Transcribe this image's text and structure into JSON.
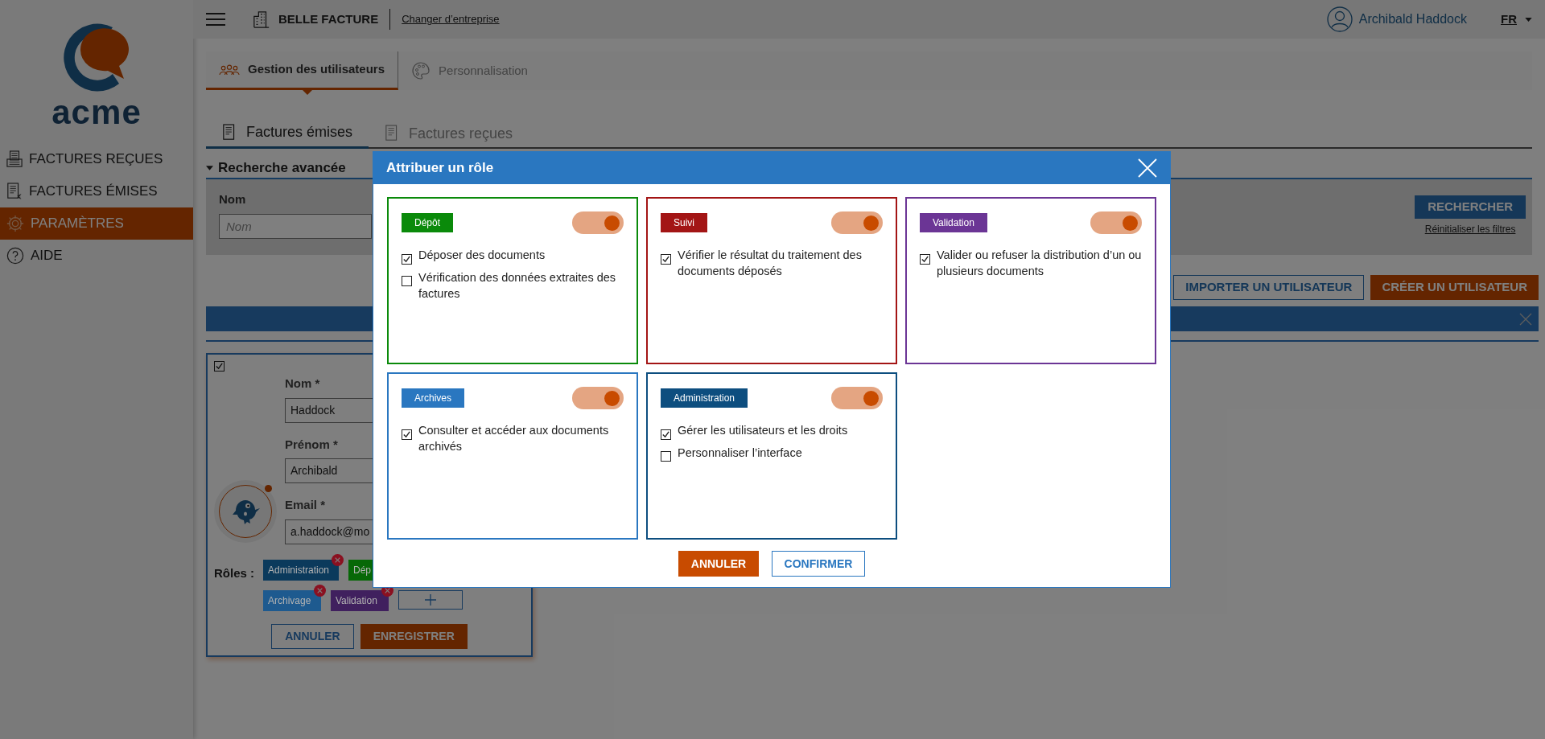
{
  "logo": {
    "text": "acme"
  },
  "sidebar": {
    "items": [
      {
        "label": "FACTURES REÇUES",
        "selected": false
      },
      {
        "label": "FACTURES ÉMISES",
        "selected": false
      },
      {
        "label": "PARAMÈTRES",
        "selected": true
      },
      {
        "label": "AIDE",
        "selected": false
      }
    ]
  },
  "topbar": {
    "company": "BELLE FACTURE",
    "switch_link": "Changer d’entreprise",
    "user": "Archibald Haddock",
    "language": "FR"
  },
  "tabs": [
    {
      "label": "Gestion des utilisateurs",
      "selected": true
    },
    {
      "label": "Personnalisation",
      "selected": false
    }
  ],
  "subtabs": [
    {
      "label": "Factures émises",
      "selected": true
    },
    {
      "label": "Factures reçues",
      "selected": false
    }
  ],
  "search": {
    "title": "Recherche avancée",
    "expanded": true,
    "field_label": "Nom",
    "placeholder": "Nom",
    "search_button": "RECHERCHER",
    "reset_link": "Réinitialiser les filtres"
  },
  "actions": {
    "import": "IMPORTER UN UTILISATEUR",
    "create": "CRÉER UN UTILISATEUR"
  },
  "user_card": {
    "checked": true,
    "fields": [
      {
        "label": "Nom *",
        "value": "Haddock"
      },
      {
        "label": "Prénom *",
        "value": "Archibald"
      },
      {
        "label": "Email *",
        "value": "a.haddock@mo"
      }
    ],
    "roles_label": "Rôles :",
    "roles": [
      {
        "label": "Administration",
        "color": "#0b3a5c",
        "removable": true
      },
      {
        "label": "Dép",
        "color": "#076807"
      },
      {
        "label": "Archivage",
        "color": "#1e5a8f",
        "removable": true
      },
      {
        "label": "Validation",
        "color": "#40205e",
        "removable": true
      }
    ],
    "cancel": "ANNULER",
    "save": "ENREGISTRER"
  },
  "modal": {
    "title": "Attribuer un rôle",
    "roles": [
      {
        "name": "Dépôt",
        "color": "#0a8a0a",
        "on": true,
        "permissions": [
          {
            "label": "Déposer des documents",
            "checked": true
          },
          {
            "label": "Vérification des données extraites des factures",
            "checked": false
          }
        ]
      },
      {
        "name": "Suivi",
        "color": "#a31515",
        "on": true,
        "permissions": [
          {
            "label": "Vérifier le résultat du traitement des documents déposés",
            "checked": true
          }
        ]
      },
      {
        "name": "Validation",
        "color": "#6b3595",
        "on": true,
        "permissions": [
          {
            "label": "Valider ou refuser la distribution d’un ou plusieurs documents",
            "checked": true
          }
        ]
      },
      {
        "name": "Archives",
        "color": "#2a77c0",
        "on": true,
        "permissions": [
          {
            "label": "Consulter et accéder aux documents archivés",
            "checked": true
          }
        ]
      },
      {
        "name": "Administration",
        "color": "#0d4e7f",
        "on": true,
        "permissions": [
          {
            "label": "Gérer les utilisateurs et les droits",
            "checked": true
          },
          {
            "label": "Personnaliser l’interface",
            "checked": false
          }
        ]
      }
    ],
    "cancel": "ANNULER",
    "confirm": "CONFIRMER"
  }
}
